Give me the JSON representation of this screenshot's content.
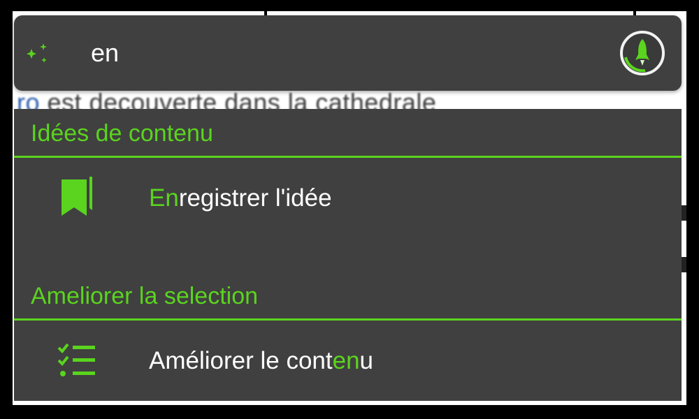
{
  "background": {
    "doc_text_lead": "ro",
    "doc_text_rest": " est decouverte dans la cathedrale"
  },
  "prompt": {
    "value": "en",
    "sparkle_icon": "sparkle-icon",
    "action_icon": "rocket-icon"
  },
  "dropdown": {
    "sections": [
      {
        "title": "Idées de contenu",
        "items": [
          {
            "icon": "bookmark-icon",
            "label_highlight": "En",
            "label_rest": "registrer l'idée"
          }
        ]
      },
      {
        "title": "Ameliorer la selection",
        "items": [
          {
            "icon": "checklist-icon",
            "label_before": "Améliorer le cont",
            "label_highlight": "en",
            "label_after": "u"
          }
        ]
      }
    ]
  },
  "colors": {
    "accent": "#5ad41e",
    "panel": "#404040",
    "text": "#ffffff"
  }
}
